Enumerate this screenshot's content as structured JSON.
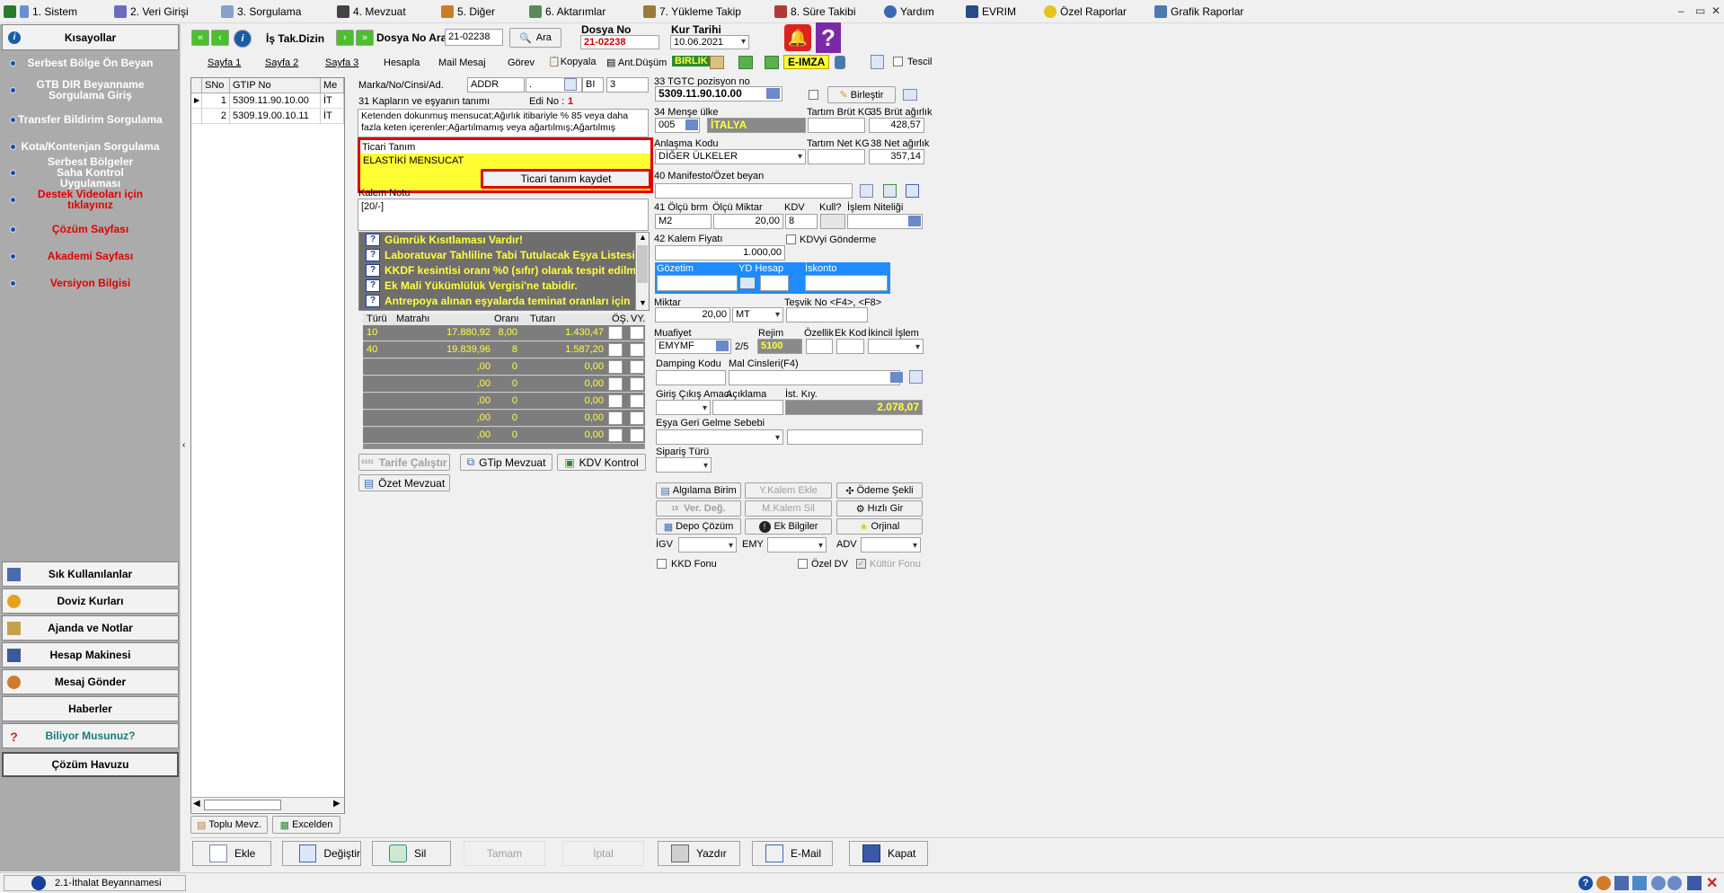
{
  "menu": {
    "items": [
      "1. Sistem",
      "2. Veri Girişi",
      "3. Sorgulama",
      "4. Mevzuat",
      "5. Diğer",
      "6. Aktarımlar",
      "7. Yükleme Takip",
      "8. Süre Takibi",
      "Yardım",
      "EVRIM",
      "Özel Raporlar",
      "Grafik Raporlar"
    ],
    "window_controls": [
      "‒",
      "▭",
      "✕"
    ]
  },
  "sidebar": {
    "header": "Kısayollar",
    "items": [
      {
        "label": "Serbest Bölge Ön Beyan",
        "red": false
      },
      {
        "label": "GTB DIR Beyanname Sorgulama Giriş",
        "red": false
      },
      {
        "label": "Transfer Bildirim Sorgulama",
        "red": false
      },
      {
        "label": "Kota/Kontenjan Sorgulama",
        "red": false
      },
      {
        "label": "Serbest Bölgeler Saha Kontrol Uygulaması",
        "red": false
      },
      {
        "label": "Destek Videoları için tıklayınız",
        "red": true
      },
      {
        "label": "Çözüm Sayfası",
        "red": true
      },
      {
        "label": "Akademi Sayfası",
        "red": true
      },
      {
        "label": "Versiyon Bilgisi",
        "red": true
      }
    ],
    "bottom_buttons": [
      "Sık Kullanılanlar",
      "Doviz Kurları",
      "Ajanda ve Notlar",
      "Hesap Makinesi",
      "Mesaj Gönder",
      "Haberler",
      "Biliyor Musunuz?",
      "Çözüm Havuzu"
    ]
  },
  "toolbar": {
    "is_tak_dizin": "İş Tak.Dizin",
    "dosya_no_ara_label": "Dosya No Ara",
    "dosya_no_ara_value": "21-02238",
    "ara_button": "Ara",
    "dosya_no_label": "Dosya No",
    "dosya_no_value": "21-02238",
    "kur_tarihi_label": "Kur Tarihi",
    "kur_tarihi_value": "10.06.2021"
  },
  "tabs": [
    "Sayfa 1",
    "Sayfa 2",
    "Sayfa 3",
    "Hesapla",
    "Mail Mesaj",
    "Görev",
    "Kopyala",
    "Ant.Düşüm",
    "BIRLIK",
    "E-IMZA",
    "Tescil"
  ],
  "left_grid": {
    "headers": [
      "SNo",
      "GTIP No",
      "Me"
    ],
    "rows": [
      {
        "sno": "1",
        "gtip": "5309.11.90.10.00",
        "me": "İT"
      },
      {
        "sno": "2",
        "gtip": "5309.19.00.10.11",
        "me": "İT"
      }
    ],
    "buttons": [
      "Toplu Mevz.",
      "Excelden"
    ]
  },
  "item": {
    "marka_label": "Marka/No/Cinsi/Ad.",
    "marka_value": "ADDR",
    "marka_extra": ".",
    "bi_value": "BI",
    "count_value": "3",
    "kaplar_label": "31 Kapların ve eşyanın tanımı",
    "edi_no_label": "Edi No :",
    "edi_no_value": "1",
    "description": "Ketenden dokunmuş mensucat;Ağırlık itibariyle % 85 veya daha fazla keten içerenler;Ağartılmamış veya ağartılmış;Ağartılmış",
    "ticari_tanim_label": "Ticari Tanım",
    "ticari_tanim_value": "ELASTİKİ MENSUCAT",
    "ticari_kaydet_button": "Ticari tanım kaydet",
    "kalem_notu_label": "Kalem Notu",
    "kalem_notu_value": "[20/-]",
    "warnings": [
      "Gümrük Kısıtlaması Vardır!",
      "Laboratuvar Tahliline Tabi Tutulacak Eşya Listesi",
      "KKDF kesintisi oranı %0 (sıfır) olarak tespit edilmiştir",
      "Ek Mali Yükümlülük Vergisi'ne tabidir.",
      "Antrepoya alınan eşyalarda teminat oranları için"
    ]
  },
  "vergi": {
    "headers": [
      "Türü",
      "Matrahı",
      "Oranı",
      "Tutarı",
      "ÖŞ.",
      "VY."
    ],
    "rows": [
      {
        "turu": "10",
        "matrah": "17.880,92",
        "oran": "8,00",
        "tutar": "1.430,47"
      },
      {
        "turu": "40",
        "matrah": "19.839,96",
        "oran": "8",
        "tutar": "1.587,20"
      },
      {
        "turu": "",
        "matrah": ",00",
        "oran": "0",
        "tutar": "0,00"
      },
      {
        "turu": "",
        "matrah": ",00",
        "oran": "0",
        "tutar": "0,00"
      },
      {
        "turu": "",
        "matrah": ",00",
        "oran": "0",
        "tutar": "0,00"
      },
      {
        "turu": "",
        "matrah": ",00",
        "oran": "0",
        "tutar": "0,00"
      },
      {
        "turu": "",
        "matrah": ",00",
        "oran": "0",
        "tutar": "0,00"
      }
    ],
    "buttons": [
      "Tarife Çalıştır",
      "GTip Mevzuat",
      "KDV Kontrol",
      "Özet Mevzuat"
    ]
  },
  "right": {
    "tgtc_label": "33 TGTC pozisyon no",
    "tgtc_value": "5309.11.90.10.00",
    "birlestir": "Birleştir",
    "mense_label": "34 Menşe ülke",
    "mense_code": "005",
    "mense_name": "İTALYA",
    "tartim_brut_label": "Tartım Brüt KG",
    "brut_label": "35 Brüt ağırlık",
    "brut_value": "428,57",
    "anlasma_label": "Anlaşma Kodu",
    "anlasma_value": "DİĞER ÜLKELER",
    "tartim_net_label": "Tartım Net KG",
    "net_label": "38 Net ağırlık",
    "net_value": "357,14",
    "manifesto_label": "40 Manifesto/Özet beyan",
    "olcu_birim_label": "41 Ölçü brm",
    "olcu_miktar_label": "Ölçü Miktar",
    "kdv_label": "KDV",
    "kull_label": "Kull?",
    "islem_label": "İşlem Niteliği",
    "olcu_birim_value": "M2",
    "olcu_miktar_value": "20,00",
    "kdv_value": "8",
    "kalem_fiyati_label": "42 Kalem Fiyatı",
    "kdv_gonderme": "KDVyi Gönderme",
    "kalem_fiyati_value": "1.000,00",
    "gozetim_label": "Gözetim",
    "yd_hesap_label": "YD Hesap",
    "iskonto_label": "İskonto",
    "miktar_label": "Miktar",
    "miktar_value": "20,00",
    "miktar_unit": "MT",
    "tesvik_label": "Teşvik No <F4>, <F8>",
    "muafiyet_label": "Muafiyet",
    "muafiyet_value": "EMYMF",
    "muafiyet_frac": "2/5",
    "rejim_label": "Rejim",
    "rejim_value": "5100",
    "ozellik_label": "Özellik",
    "ek_kod_label": "Ek Kod",
    "ikincil_label": "İkincil İşlem",
    "damping_label": "Damping Kodu",
    "mal_cinsleri_label": "Mal Cinsleri(F4)",
    "giris_cikis_label": "Giriş Çıkış Amacı",
    "aciklama_label": "Açıklama",
    "ist_kiy_label": "İst. Kıy.",
    "ist_kiy_value": "2.078,07",
    "esya_geri_label": "Eşya Geri Gelme Sebebi",
    "siparis_label": "Sipariş Türü",
    "action_buttons": [
      "Algılama Birim",
      "Y.Kalem Ekle",
      "Ödeme Şekli",
      "Ver. Değ.",
      "M.Kalem Sil",
      "Hızlı Gir",
      "Depo Çözüm",
      "Ek Bilgiler",
      "Orjinal"
    ],
    "igv_label": "İGV",
    "emy_label": "EMY",
    "adv_label": "ADV",
    "kkd_fonu": "KKD Fonu",
    "ozel_dv": "Özel DV",
    "kultur_fonu": "Kültür Fonu"
  },
  "bottom_bar": [
    "Ekle",
    "Değiştir",
    "Sil",
    "Tamam",
    "İptal",
    "Yazdır",
    "E-Mail",
    "Kapat"
  ],
  "status": {
    "module": "2.1-İthalat Beyannamesi"
  },
  "colors": {
    "sidebar_bg": "#ababab",
    "highlight_yellow": "#ffff33",
    "warning_bg": "#6e6e6e",
    "red_border": "#e00000",
    "blue_panel": "#1e8cff"
  }
}
